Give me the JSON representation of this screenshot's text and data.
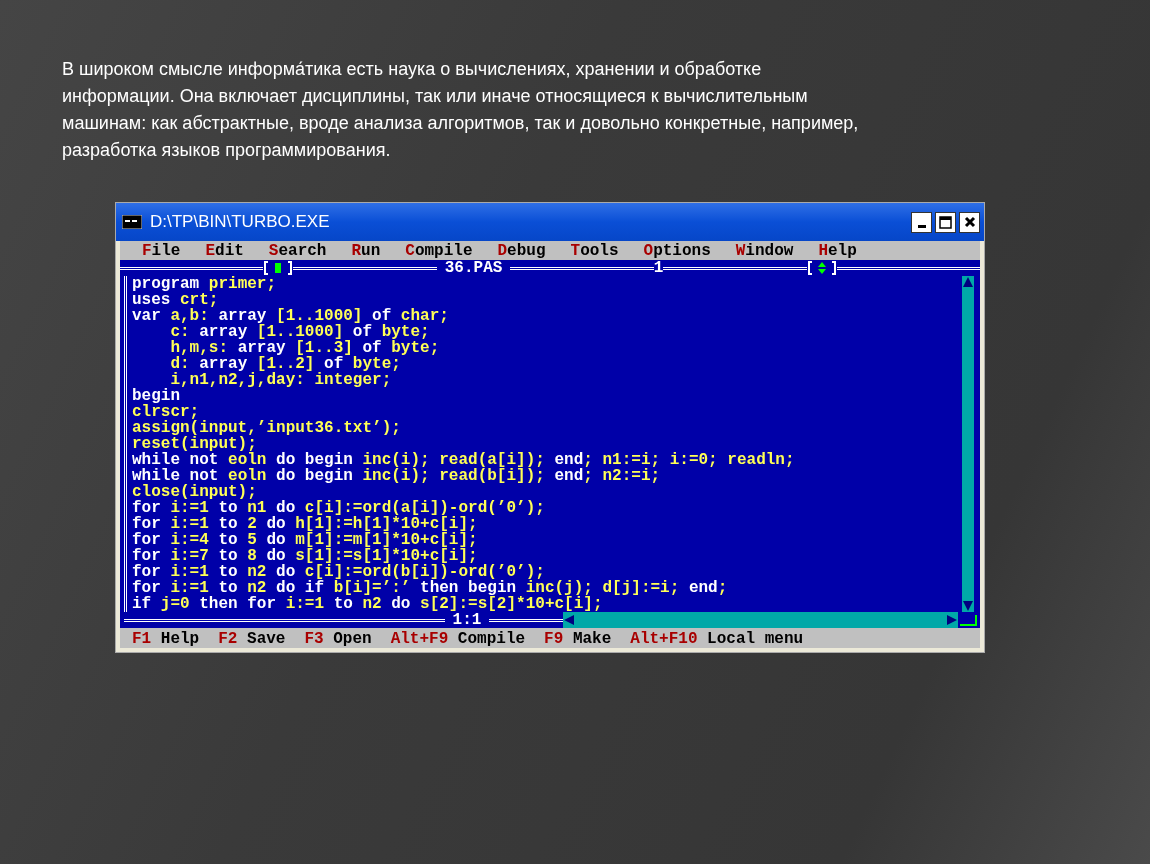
{
  "slide": {
    "paragraph": "В широком смысле информа́тика есть наука о вычислениях, хранении и обработке информации. Она включает дисциплины, так или иначе относящиеся к вычислительным машинам: как абстрактные, вроде анализа алгоритмов, так и довольно конкретные, например, разработка языков программирования."
  },
  "window": {
    "title": "D:\\TP\\BIN\\TURBO.EXE"
  },
  "menu": [
    "File",
    "Edit",
    "Search",
    "Run",
    "Compile",
    "Debug",
    "Tools",
    "Options",
    "Window",
    "Help"
  ],
  "editor": {
    "file_name": "36.PAS",
    "window_number": "1",
    "cursor_position": "1:1",
    "lines": [
      [
        {
          "text": "program",
          "kind": "keyword"
        },
        {
          "text": " primer;",
          "kind": "plain"
        }
      ],
      [
        {
          "text": "uses",
          "kind": "keyword"
        },
        {
          "text": " crt;",
          "kind": "plain"
        }
      ],
      [
        {
          "text": "var",
          "kind": "keyword"
        },
        {
          "text": " a,b: ",
          "kind": "plain"
        },
        {
          "text": "array",
          "kind": "keyword"
        },
        {
          "text": " [1..1000] ",
          "kind": "plain"
        },
        {
          "text": "of",
          "kind": "keyword"
        },
        {
          "text": " char;",
          "kind": "plain"
        }
      ],
      [
        {
          "text": "    c: ",
          "kind": "plain"
        },
        {
          "text": "array",
          "kind": "keyword"
        },
        {
          "text": " [1..1000] ",
          "kind": "plain"
        },
        {
          "text": "of",
          "kind": "keyword"
        },
        {
          "text": " byte;",
          "kind": "plain"
        }
      ],
      [
        {
          "text": "    h,m,s: ",
          "kind": "plain"
        },
        {
          "text": "array",
          "kind": "keyword"
        },
        {
          "text": " [1..3] ",
          "kind": "plain"
        },
        {
          "text": "of",
          "kind": "keyword"
        },
        {
          "text": " byte;",
          "kind": "plain"
        }
      ],
      [
        {
          "text": "    d: ",
          "kind": "plain"
        },
        {
          "text": "array",
          "kind": "keyword"
        },
        {
          "text": " [1..2] ",
          "kind": "plain"
        },
        {
          "text": "of",
          "kind": "keyword"
        },
        {
          "text": " byte;",
          "kind": "plain"
        }
      ],
      [
        {
          "text": "    i,n1,n2,j,day: integer;",
          "kind": "plain"
        }
      ],
      [
        {
          "text": "begin",
          "kind": "keyword"
        }
      ],
      [
        {
          "text": "clrscr;",
          "kind": "plain"
        }
      ],
      [
        {
          "text": "assign(input,’input36.txt’);",
          "kind": "plain"
        }
      ],
      [
        {
          "text": "reset(input);",
          "kind": "plain"
        }
      ],
      [
        {
          "text": "while not",
          "kind": "keyword"
        },
        {
          "text": " eoln ",
          "kind": "plain"
        },
        {
          "text": "do begin",
          "kind": "keyword"
        },
        {
          "text": " inc(i); read(a[i]); ",
          "kind": "plain"
        },
        {
          "text": "end",
          "kind": "keyword"
        },
        {
          "text": "; n1:=i; i:=0; readln;",
          "kind": "plain"
        }
      ],
      [
        {
          "text": "while not",
          "kind": "keyword"
        },
        {
          "text": " eoln ",
          "kind": "plain"
        },
        {
          "text": "do begin",
          "kind": "keyword"
        },
        {
          "text": " inc(i); read(b[i]); ",
          "kind": "plain"
        },
        {
          "text": "end",
          "kind": "keyword"
        },
        {
          "text": "; n2:=i;",
          "kind": "plain"
        }
      ],
      [
        {
          "text": "close(input);",
          "kind": "plain"
        }
      ],
      [
        {
          "text": "for",
          "kind": "keyword"
        },
        {
          "text": " i:=1 ",
          "kind": "plain"
        },
        {
          "text": "to",
          "kind": "keyword"
        },
        {
          "text": " n1 ",
          "kind": "plain"
        },
        {
          "text": "do",
          "kind": "keyword"
        },
        {
          "text": " c[i]:=ord(a[i])-ord(’0’);",
          "kind": "plain"
        }
      ],
      [
        {
          "text": "for",
          "kind": "keyword"
        },
        {
          "text": " i:=1 ",
          "kind": "plain"
        },
        {
          "text": "to",
          "kind": "keyword"
        },
        {
          "text": " 2 ",
          "kind": "plain"
        },
        {
          "text": "do",
          "kind": "keyword"
        },
        {
          "text": " h[1]:=h[1]*10+c[i];",
          "kind": "plain"
        }
      ],
      [
        {
          "text": "for",
          "kind": "keyword"
        },
        {
          "text": " i:=4 ",
          "kind": "plain"
        },
        {
          "text": "to",
          "kind": "keyword"
        },
        {
          "text": " 5 ",
          "kind": "plain"
        },
        {
          "text": "do",
          "kind": "keyword"
        },
        {
          "text": " m[1]:=m[1]*10+c[i];",
          "kind": "plain"
        }
      ],
      [
        {
          "text": "for",
          "kind": "keyword"
        },
        {
          "text": " i:=7 ",
          "kind": "plain"
        },
        {
          "text": "to",
          "kind": "keyword"
        },
        {
          "text": " 8 ",
          "kind": "plain"
        },
        {
          "text": "do",
          "kind": "keyword"
        },
        {
          "text": " s[1]:=s[1]*10+c[i];",
          "kind": "plain"
        }
      ],
      [
        {
          "text": "for",
          "kind": "keyword"
        },
        {
          "text": " i:=1 ",
          "kind": "plain"
        },
        {
          "text": "to",
          "kind": "keyword"
        },
        {
          "text": " n2 ",
          "kind": "plain"
        },
        {
          "text": "do",
          "kind": "keyword"
        },
        {
          "text": " c[i]:=ord(b[i])-ord(’0’);",
          "kind": "plain"
        }
      ],
      [
        {
          "text": "for",
          "kind": "keyword"
        },
        {
          "text": " i:=1 ",
          "kind": "plain"
        },
        {
          "text": "to",
          "kind": "keyword"
        },
        {
          "text": " n2 ",
          "kind": "plain"
        },
        {
          "text": "do if",
          "kind": "keyword"
        },
        {
          "text": " b[i]=’:’ ",
          "kind": "plain"
        },
        {
          "text": "then begin",
          "kind": "keyword"
        },
        {
          "text": " inc(j); d[j]:=i; ",
          "kind": "plain"
        },
        {
          "text": "end",
          "kind": "keyword"
        },
        {
          "text": ";",
          "kind": "plain"
        }
      ],
      [
        {
          "text": "if",
          "kind": "keyword"
        },
        {
          "text": " j=0 ",
          "kind": "plain"
        },
        {
          "text": "then for",
          "kind": "keyword"
        },
        {
          "text": " i:=1 ",
          "kind": "plain"
        },
        {
          "text": "to",
          "kind": "keyword"
        },
        {
          "text": " n2 ",
          "kind": "plain"
        },
        {
          "text": "do",
          "kind": "keyword"
        },
        {
          "text": " s[2]:=s[2]*10+c[i];",
          "kind": "plain"
        }
      ]
    ]
  },
  "status_bar": [
    {
      "key": "F1",
      "label": "Help"
    },
    {
      "key": "F2",
      "label": "Save"
    },
    {
      "key": "F3",
      "label": "Open"
    },
    {
      "key": "Alt+F9",
      "label": "Compile"
    },
    {
      "key": "F9",
      "label": "Make"
    },
    {
      "key": "Alt+F10",
      "label": "Local menu"
    }
  ]
}
